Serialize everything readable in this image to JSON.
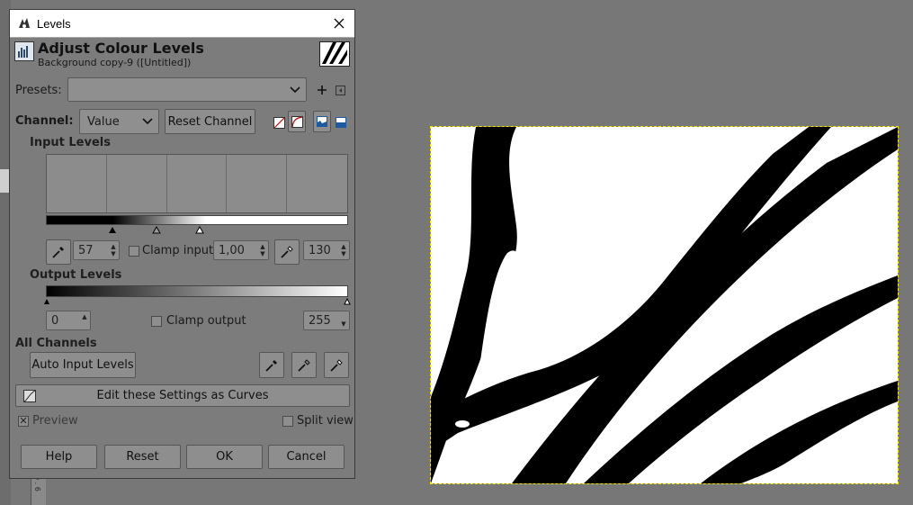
{
  "window": {
    "title": "Levels"
  },
  "header": {
    "title": "Adjust Colour Levels",
    "subtitle": "Background copy-9 ([Untitled])"
  },
  "presets": {
    "label": "Presets:",
    "value": ""
  },
  "channel": {
    "label": "Channel:",
    "value": "Value",
    "reset_label": "Reset Channel"
  },
  "input_levels": {
    "heading": "Input Levels",
    "low": "57",
    "gamma": "1,00",
    "high": "130",
    "clamp_label": "Clamp input"
  },
  "output_levels": {
    "heading": "Output Levels",
    "low": "0",
    "high": "255",
    "clamp_label": "Clamp output"
  },
  "all_channels": {
    "heading": "All Channels",
    "auto_label": "Auto Input Levels"
  },
  "curves_label": "Edit these Settings as Curves",
  "preview_label": "Preview",
  "split_label": "Split view",
  "buttons": {
    "help": "Help",
    "reset": "Reset",
    "ok": "OK",
    "cancel": "Cancel"
  },
  "icons": {
    "app": "gimp-wilber-icon",
    "close": "close-icon",
    "header": "levels-histogram-icon",
    "picker": "eyedropper-icon",
    "curves": "curves-icon"
  },
  "colors": {
    "dialog_bg": "#7c7c7c",
    "canvas_selection": "#f5e400"
  },
  "bg_ruler_ticks": "0 . 6"
}
